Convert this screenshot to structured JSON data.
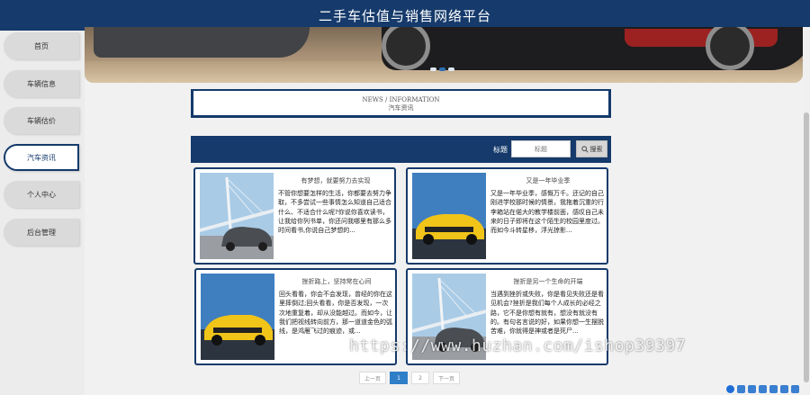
{
  "header": {
    "title": "二手车估值与销售网络平台"
  },
  "sidebar": {
    "items": [
      {
        "label": "首页"
      },
      {
        "label": "车辆信息"
      },
      {
        "label": "车辆估价"
      },
      {
        "label": "汽车资讯"
      },
      {
        "label": "个人中心"
      },
      {
        "label": "后台管理"
      }
    ],
    "active_index": 3
  },
  "banner": {
    "dots": 3,
    "active_dot": 1
  },
  "section": {
    "en": "NEWS / INFORMATION",
    "zh": "汽车资讯"
  },
  "search": {
    "label": "标题",
    "placeholder": "标题",
    "button_label": "搜索"
  },
  "articles": [
    {
      "title": "有梦想，就要努力去实现",
      "summary": "不管你想要怎样的生活，你都要去努力争取，不多尝试一些事情怎么知道自己适合什么、不适合什么呢?你说你喜欢读书，让我给你列书单，你还问我哪里有那么多时间看书,你说自己梦想的...",
      "image": "white-car"
    },
    {
      "title": "又是一年毕业季",
      "summary": "又是一年毕业季，感慨万千。还记的自己刚进学校那时候的情景，我拖着沉重的行李箱站在偌大的教学楼前面，感叹自己未来的日子即将在这个陌生的校园里度过。而如今斗转星移，浮光掠影...",
      "image": "yellow-car"
    },
    {
      "title": "挫折路上，坚持常在心间",
      "summary": "回头看看，你会不会发现，曾经的你在这里摔倒过;回头看看，你是否发现，一次次地重复着，却从没能越过。而如今，让我们把视线转向前方，那一道道金色的弧线，是鸿雁飞过的痕迹，或...",
      "image": "yellow-car"
    },
    {
      "title": "挫折是另一个生命的开端",
      "summary": "当遇到挫折或失败，你是看见失败还是看见机会?挫折是我们每个人成长的必经之路，它不是你想有就有，想没有就没有的。有句名言说的好，如果你想一生摆脱苦难，你就得是神或者是死尸...",
      "image": "white-car"
    }
  ],
  "pagination": {
    "prev": "上一页",
    "pages": [
      "1",
      "2"
    ],
    "current": "1",
    "next": "下一页"
  },
  "watermark": "https://www.huzhan.com/ishop39397",
  "colors": {
    "primary": "#153a6b",
    "page_active": "#2f7ec8"
  }
}
